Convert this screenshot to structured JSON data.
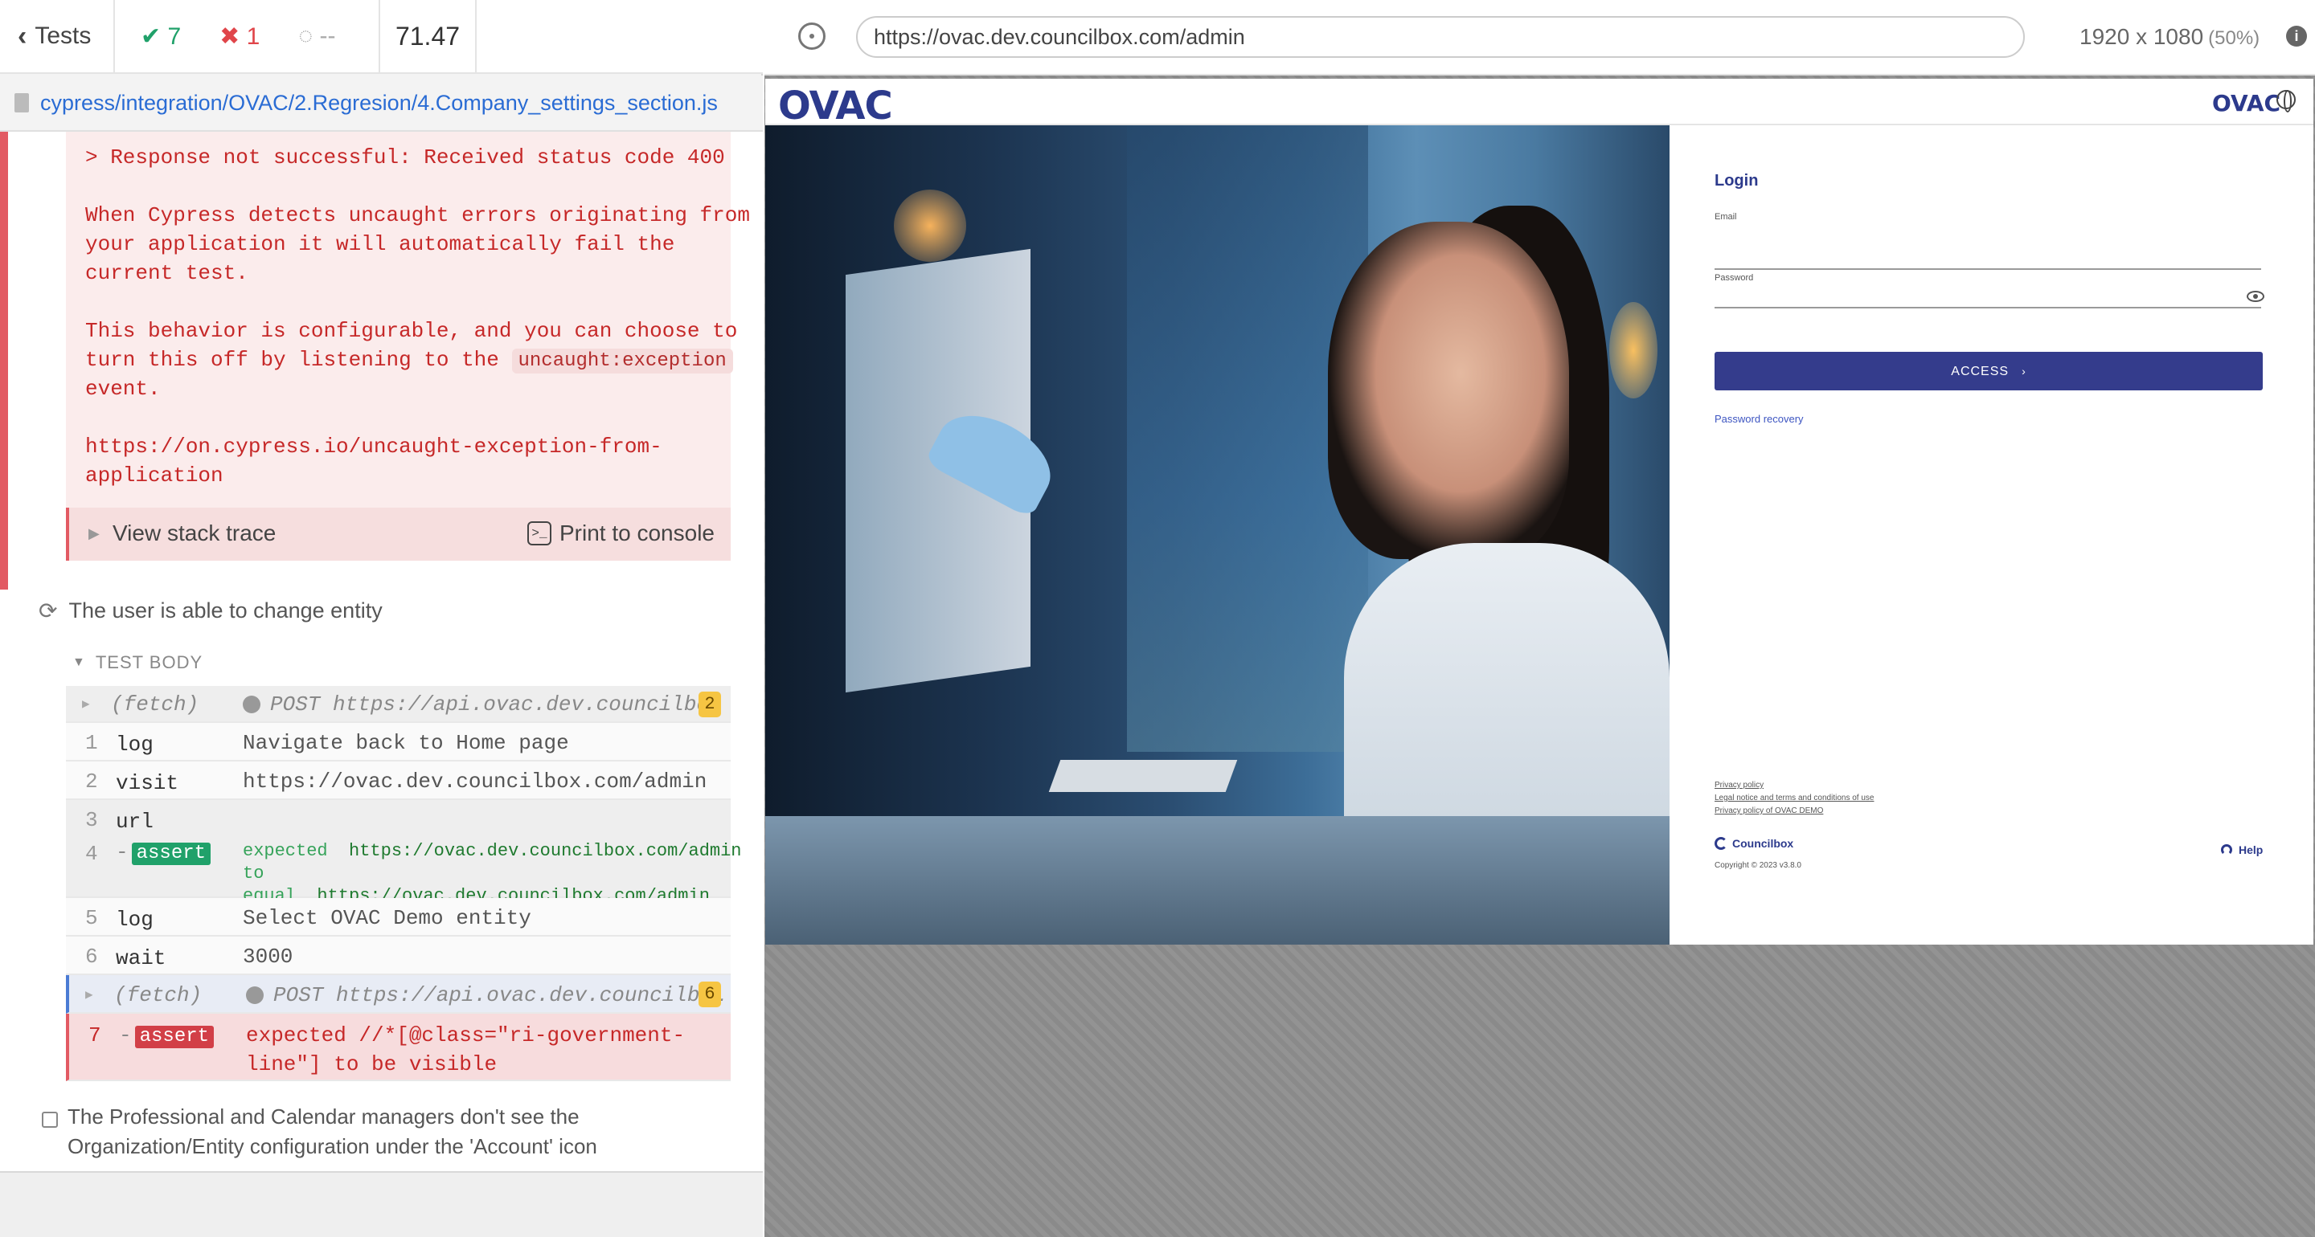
{
  "reporter": {
    "tests_label": "Tests",
    "passed": "7",
    "failed": "1",
    "pending": "--",
    "duration": "71.47",
    "spec_path": "cypress/integration/OVAC/2.Regresion/4.Company_settings_section.js"
  },
  "error": {
    "response_line": "  > Response not successful: Received status code 400",
    "para1_l1": "When Cypress detects uncaught errors originating from",
    "para1_l2": "your application it will automatically fail the",
    "para1_l3": "current test.",
    "para2_l1": "This behavior is configurable, and you can choose to",
    "para2_l2": "turn this off by listening to the",
    "para2_code": "uncaught:exception",
    "para2_l3": "event.",
    "link_l1": "https://on.cypress.io/uncaught-exception-from-",
    "link_l2": "application",
    "view_stack": "View stack trace",
    "print_console": "Print to console"
  },
  "test": {
    "title": "The user is able to change entity",
    "body_label": "TEST BODY",
    "fetch1_name": "(fetch)",
    "fetch1_msg": "POST https://api.ovac.dev.councilbo…",
    "fetch1_count": "2",
    "commands": [
      {
        "num": "1",
        "name": "log",
        "msg": "Navigate back to Home page"
      },
      {
        "num": "2",
        "name": "visit",
        "msg": "https://ovac.dev.councilbox.com/admin"
      },
      {
        "num": "3",
        "name": "url",
        "msg": ""
      },
      {
        "num": "4",
        "name": "assert",
        "exp_k": "expected",
        "exp_v": "https://ovac.dev.councilbox.com/admin",
        "eq_k": "to equal",
        "eq_v": "https://ovac.dev.councilbox.com/admin"
      },
      {
        "num": "5",
        "name": "log",
        "msg": "Select OVAC Demo entity"
      },
      {
        "num": "6",
        "name": "wait",
        "msg": "3000"
      }
    ],
    "fetch2_name": "(fetch)",
    "fetch2_msg": "POST https://api.ovac.dev.councilbo…",
    "fetch2_count": "6",
    "failed_cmd": {
      "num": "7",
      "name": "assert",
      "msg_l1": "expected //*[@class=\"ri-government-",
      "msg_l2": "line\"] to be visible"
    }
  },
  "pending_test": {
    "line1": "The Professional and Calendar managers don't see the",
    "line2": "Organization/Entity configuration under the 'Account' icon"
  },
  "browser": {
    "url": "https://ovac.dev.councilbox.com/admin",
    "viewport": "1920 x 1080",
    "scale": "(50%)"
  },
  "app": {
    "logo": "OVAC",
    "logo_small": "OVAC",
    "login_title": "Login",
    "email_label": "Email",
    "password_label": "Password",
    "access_label": "ACCESS",
    "recovery": "Password recovery",
    "footer_links": [
      "Privacy policy",
      "Legal notice and terms and conditions of use",
      "Privacy policy of OVAC DEMO"
    ],
    "brand": "Councilbox",
    "copyright": "Copyright © 2023 v3.8.0",
    "help": "Help"
  },
  "colors": {
    "pass": "#20a16a",
    "fail": "#e0454a",
    "brand": "#2c3a8c",
    "access_button": "#343c8c"
  }
}
